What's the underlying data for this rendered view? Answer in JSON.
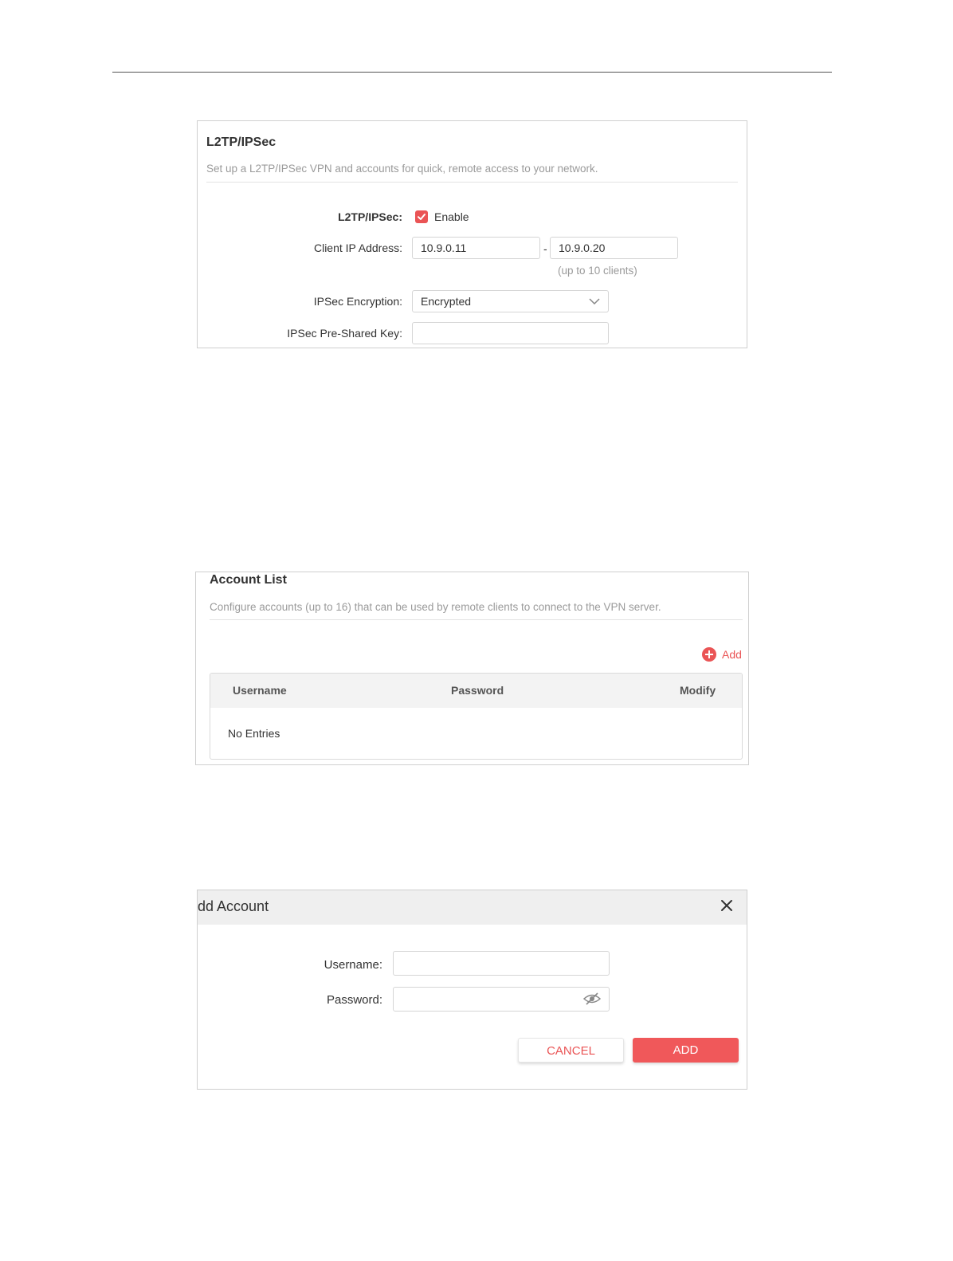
{
  "l2tp": {
    "title": "L2TP/IPSec",
    "description": "Set up a L2TP/IPSec VPN and accounts for quick, remote access to your network.",
    "enable_label": "L2TP/IPSec:",
    "enable_text": "Enable",
    "enabled": true,
    "client_ip_label": "Client IP Address:",
    "client_ip_start": "10.9.0.11",
    "client_ip_separator": "-",
    "client_ip_end": "10.9.0.20",
    "client_ip_note": "(up to 10 clients)",
    "encryption_label": "IPSec Encryption:",
    "encryption_value": "Encrypted",
    "psk_label": "IPSec Pre-Shared Key:",
    "psk_value": ""
  },
  "account_list": {
    "title": "Account List",
    "description": "Configure accounts (up to 16) that can be used by remote clients to connect to the VPN server.",
    "add_label": "Add",
    "columns": [
      "Username",
      "Password",
      "Modify"
    ],
    "empty_text": "No Entries"
  },
  "add_account": {
    "title": "dd Account",
    "username_label": "Username:",
    "username_value": "",
    "password_label": "Password:",
    "password_value": "",
    "cancel_label": "CANCEL",
    "add_label": "ADD"
  },
  "colors": {
    "accent": "#ea5455",
    "border": "#cfcfcf"
  },
  "icons": [
    "checkbox-checked-icon",
    "chevron-down-icon",
    "plus-circle-icon",
    "close-icon",
    "eye-off-icon"
  ]
}
